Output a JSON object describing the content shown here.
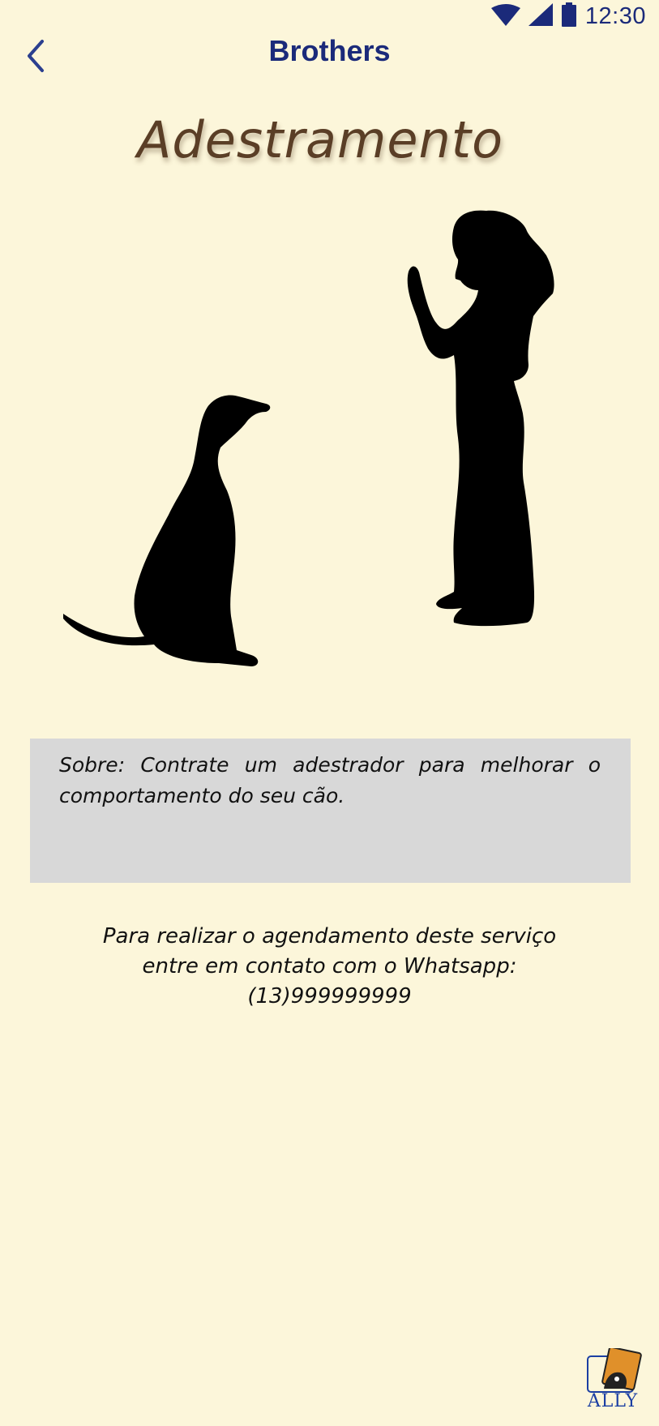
{
  "status_bar": {
    "time": "12:30",
    "icons": [
      "wifi-icon",
      "signal-icon",
      "battery-icon"
    ]
  },
  "app_bar": {
    "back_icon": "chevron-left-icon",
    "title": "Brothers"
  },
  "page": {
    "title": "Adestramento",
    "hero_image": "trainer-and-dog-silhouette"
  },
  "about": {
    "text": "Sobre: Contrate um adestrador para melhorar o comportamento do seu cão."
  },
  "contact": {
    "line1": "Para realizar o agendamento deste serviço",
    "line2": "entre em contato com o Whatsapp:",
    "phone": "(13)999999999"
  },
  "brand": {
    "logo_text": "ALLY"
  },
  "colors": {
    "background": "#fcf6da",
    "accent": "#1b2a7a",
    "title": "#5a3e26",
    "panel": "#d8d8d8"
  }
}
